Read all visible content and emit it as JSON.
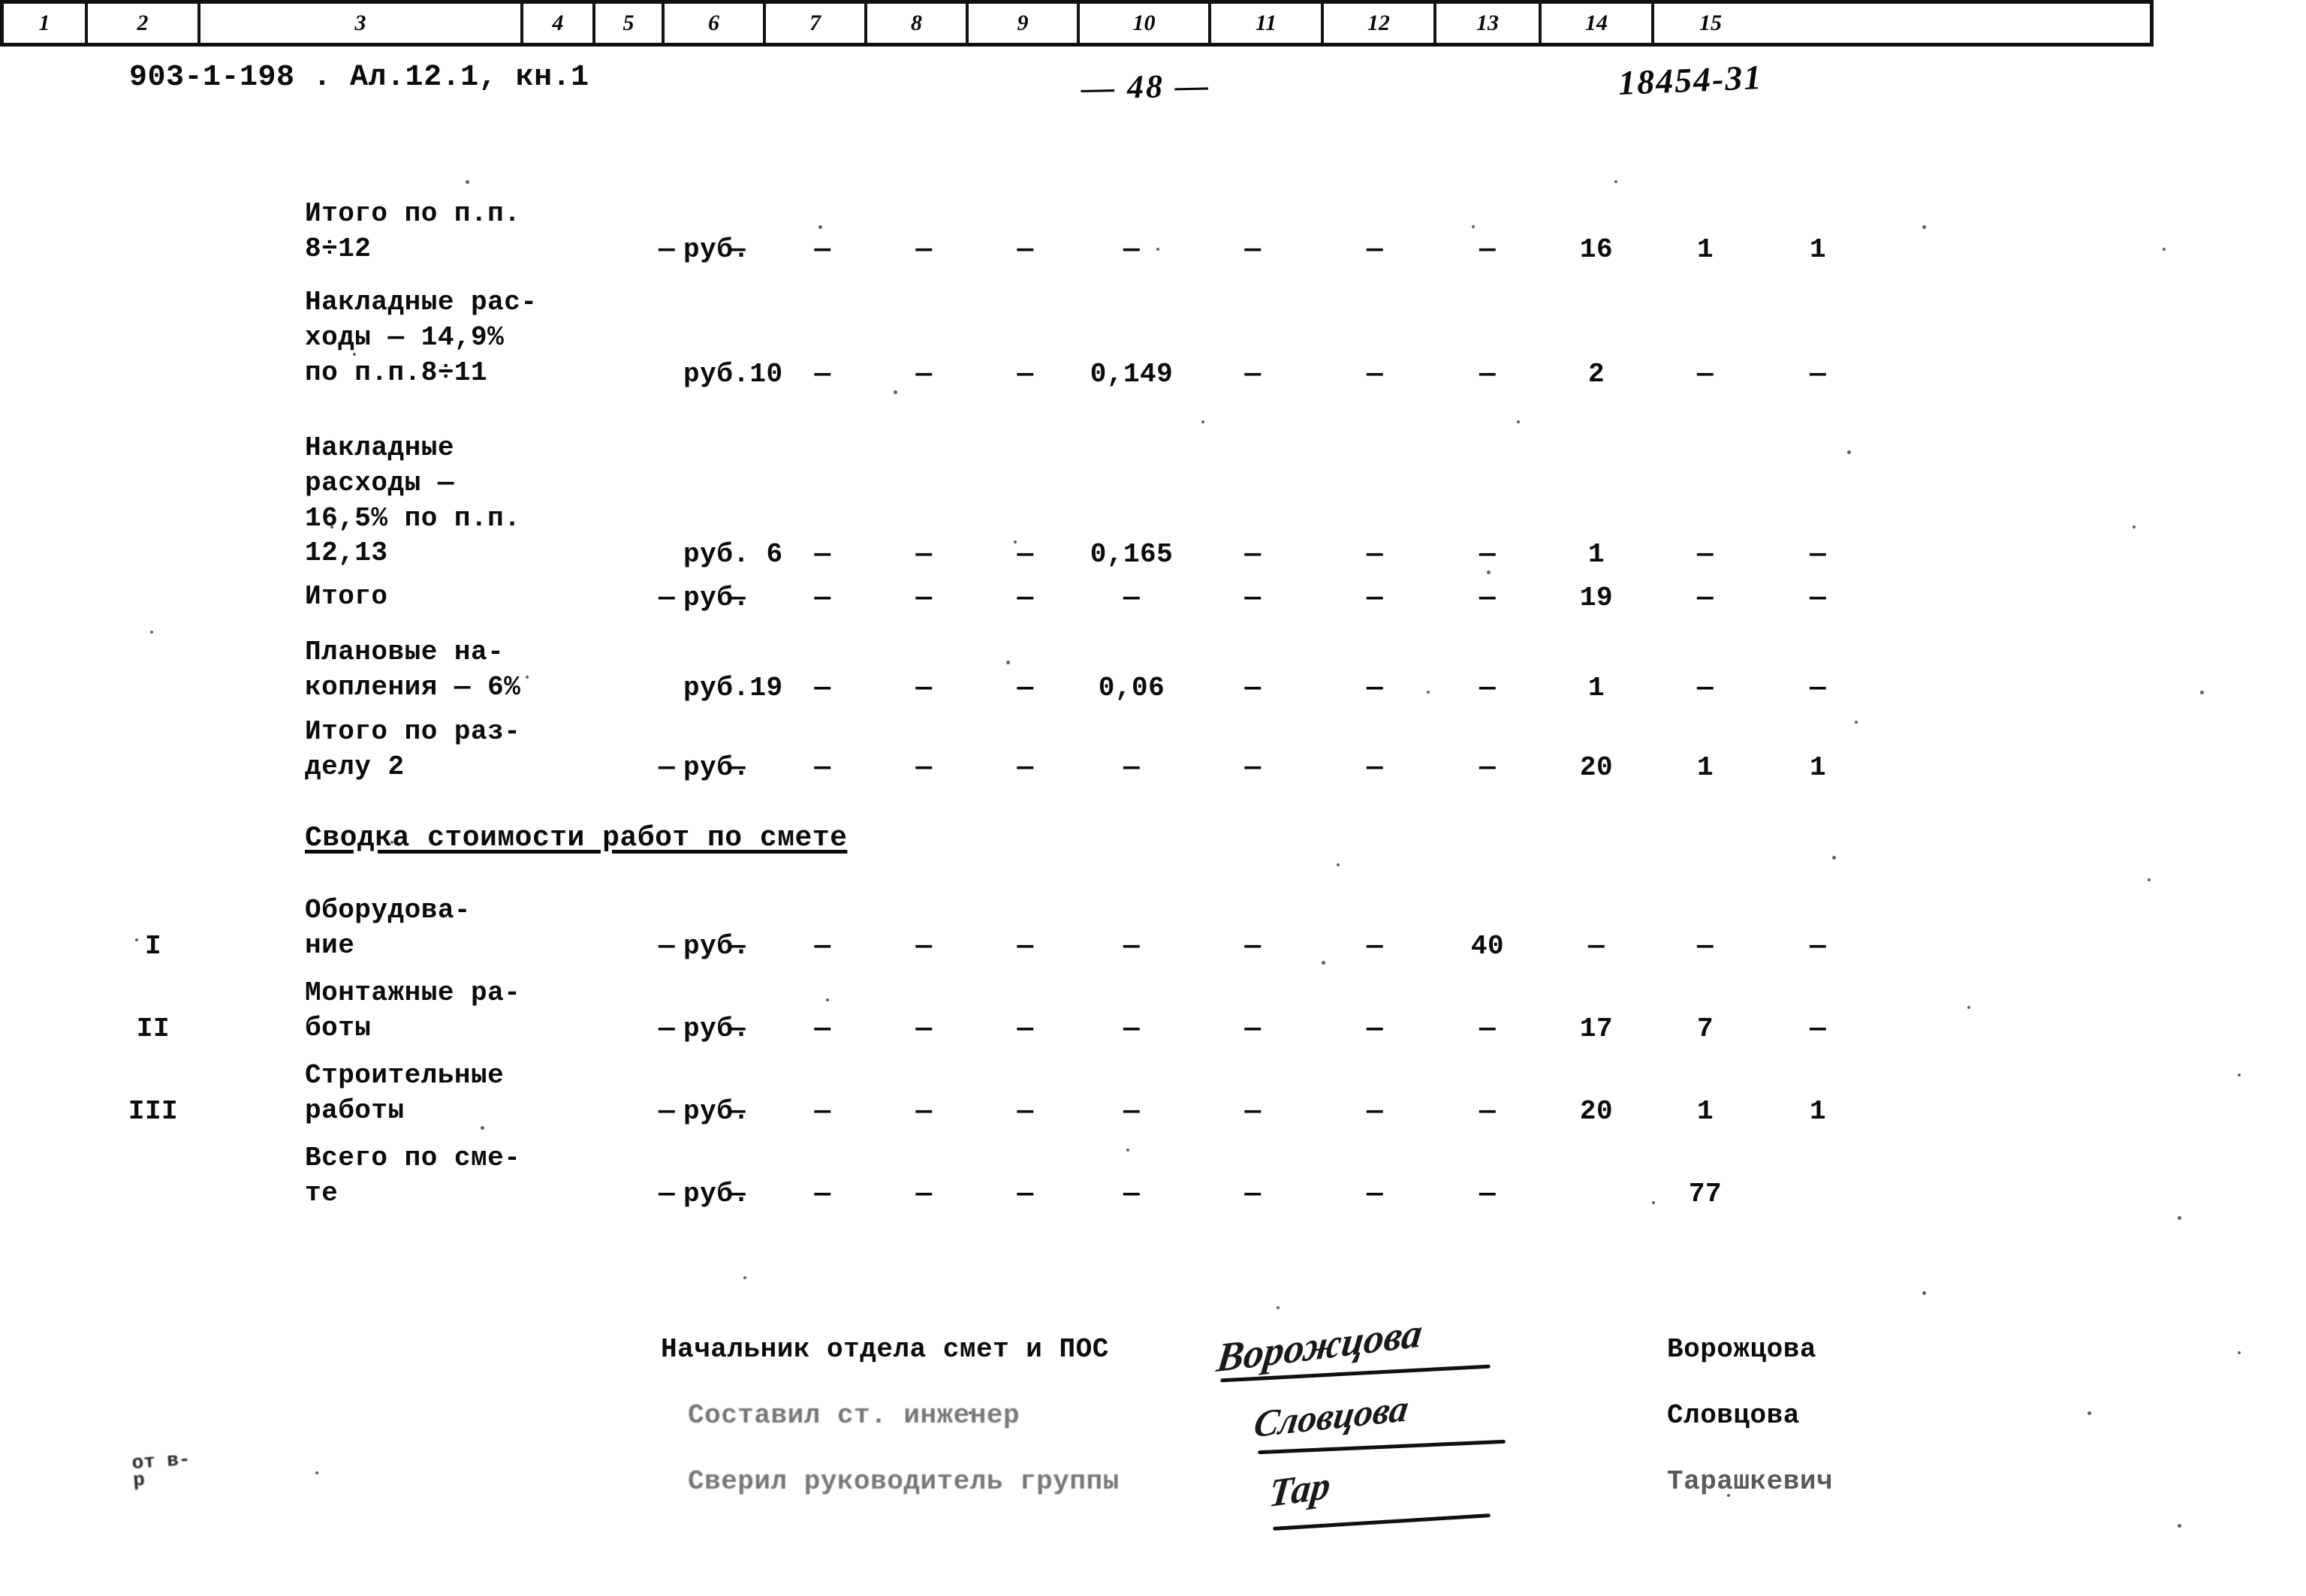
{
  "header": {
    "left_code": "903-1-198 . Ал.12.1, кн.1",
    "page_number": "— 48 —",
    "right_code": "18454-31"
  },
  "table": {
    "column_numbers": [
      "1",
      "2",
      "3",
      "4",
      "5",
      "6",
      "7",
      "8",
      "9",
      "10",
      "11",
      "12",
      "13",
      "14",
      "15"
    ],
    "dash": "—",
    "rows": [
      {
        "idx": "",
        "desc": "Итого по п.п.\n8÷12",
        "unit": "руб.",
        "c4": "—",
        "c5": "—",
        "c6": "—",
        "c7": "—",
        "c8": "—",
        "c9": "—",
        "c10": "—",
        "c11": "—",
        "c12": "—",
        "c13": "16",
        "c14": "1",
        "c15": "1"
      },
      {
        "idx": "",
        "desc": "Накладные рас-\nходы — 14,9%\nпо п.п.8÷11",
        "unit": "руб.10",
        "c4": "",
        "c5": "",
        "c6": "—",
        "c7": "—",
        "c8": "—",
        "c9": "0,149",
        "c10": "—",
        "c11": "—",
        "c12": "—",
        "c13": "2",
        "c14": "—",
        "c15": "—"
      },
      {
        "idx": "",
        "desc": "Накладные\nрасходы —\n16,5% по п.п.\n12,13",
        "unit": "руб. 6",
        "c4": "",
        "c5": "",
        "c6": "—",
        "c7": "—",
        "c8": "—",
        "c9": "0,165",
        "c10": "—",
        "c11": "—",
        "c12": "—",
        "c13": "1",
        "c14": "—",
        "c15": "—"
      },
      {
        "idx": "",
        "desc": "Итого",
        "unit": "руб.",
        "c4": "—",
        "c5": "—",
        "c6": "—",
        "c7": "—",
        "c8": "—",
        "c9": "—",
        "c10": "—",
        "c11": "—",
        "c12": "—",
        "c13": "19",
        "c14": "—",
        "c15": "—"
      },
      {
        "idx": "",
        "desc": "Плановые на-\nкопления — 6%",
        "unit": "руб.19",
        "c4": "",
        "c5": "",
        "c6": "—",
        "c7": "—",
        "c8": "—",
        "c9": "0,06",
        "c10": "—",
        "c11": "—",
        "c12": "—",
        "c13": "1",
        "c14": "—",
        "c15": "—"
      },
      {
        "idx": "",
        "desc": "Итого по раз-\nделу 2",
        "unit": "руб.",
        "c4": "—",
        "c5": "—",
        "c6": "—",
        "c7": "—",
        "c8": "—",
        "c9": "—",
        "c10": "—",
        "c11": "—",
        "c12": "—",
        "c13": "20",
        "c14": "1",
        "c15": "1"
      }
    ],
    "section_title": "Сводка стоимости работ по смете",
    "summary_rows": [
      {
        "idx": "I",
        "desc": "Оборудова-\nние",
        "unit": "руб.",
        "c4": "—",
        "c5": "—",
        "c6": "—",
        "c7": "—",
        "c8": "—",
        "c9": "—",
        "c10": "—",
        "c11": "—",
        "c12": "40",
        "c13": "—",
        "c14": "—",
        "c15": "—"
      },
      {
        "idx": "II",
        "desc": "Монтажные ра-\nботы",
        "unit": "руб.",
        "c4": "—",
        "c5": "—",
        "c6": "—",
        "c7": "—",
        "c8": "—",
        "c9": "—",
        "c10": "—",
        "c11": "—",
        "c12": "—",
        "c13": "17",
        "c14": "7",
        "c15": "—"
      },
      {
        "idx": "III",
        "desc": "Строительные\nработы",
        "unit": "руб.",
        "c4": "—",
        "c5": "—",
        "c6": "—",
        "c7": "—",
        "c8": "—",
        "c9": "—",
        "c10": "—",
        "c11": "—",
        "c12": "—",
        "c13": "20",
        "c14": "1",
        "c15": "1"
      },
      {
        "idx": "",
        "desc": "Всего по сме-\nте",
        "unit": "руб.",
        "c4": "—",
        "c5": "—",
        "c6": "—",
        "c7": "—",
        "c8": "—",
        "c9": "—",
        "c10": "—",
        "c11": "—",
        "c12": "—",
        "c13": "",
        "c14": "77",
        "c15": ""
      }
    ]
  },
  "signatures": [
    {
      "role": "Начальник отдела смет и ПОС",
      "name": "Ворожцова",
      "scribble": "Ворожцова",
      "faded": false
    },
    {
      "role": "Составил ст. инженер",
      "name": "Словцова",
      "scribble": "Словцова",
      "faded": true
    },
    {
      "role": "Сверил руководитель группы",
      "name": "Тарашкевич",
      "scribble": "Тар",
      "faded": true
    }
  ],
  "archive_mark": "от\nв-р"
}
